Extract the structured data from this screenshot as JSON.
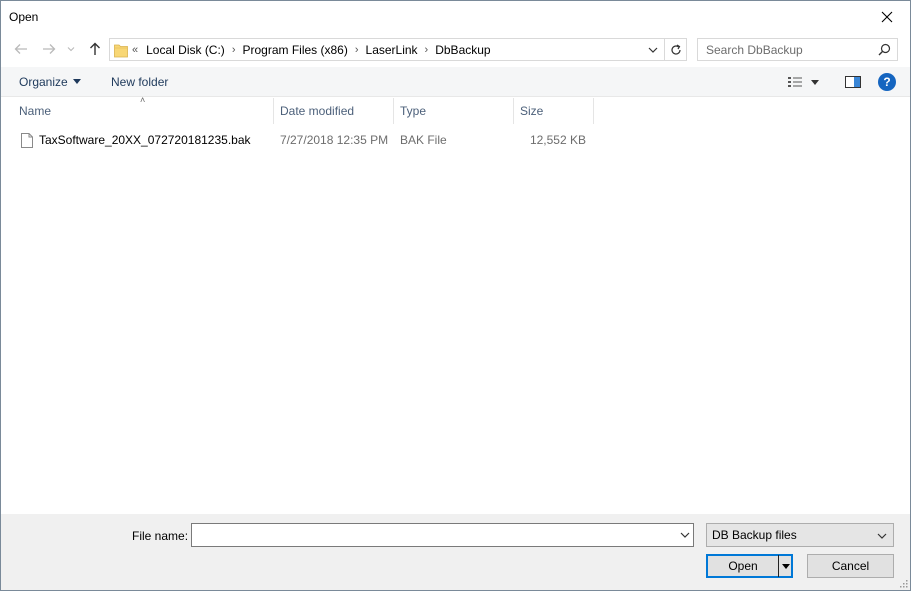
{
  "window": {
    "title": "Open"
  },
  "nav": {
    "back_icon": "arrow-left-icon",
    "forward_icon": "arrow-right-icon",
    "recent_icon": "chevron-down-icon",
    "up_icon": "arrow-up-icon"
  },
  "address": {
    "overflow": "«",
    "crumbs": [
      "Local Disk (C:)",
      "Program Files (x86)",
      "LaserLink",
      "DbBackup"
    ]
  },
  "search": {
    "placeholder": "Search DbBackup"
  },
  "commandbar": {
    "organize_label": "Organize",
    "new_folder_label": "New folder"
  },
  "columns": {
    "name": "Name",
    "date_modified": "Date modified",
    "type": "Type",
    "size": "Size"
  },
  "files": [
    {
      "name": "TaxSoftware_20XX_072720181235.bak",
      "date_modified": "7/27/2018 12:35 PM",
      "type": "BAK File",
      "size": "12,552 KB"
    }
  ],
  "bottom": {
    "file_name_label": "File name:",
    "file_name_value": "",
    "file_type_selected": "DB Backup files",
    "open_label": "Open",
    "cancel_label": "Cancel"
  },
  "colors": {
    "accent": "#0078d7",
    "help_blue": "#1565c0",
    "folder_yellow": "#f8d775",
    "header_text": "#4c607a"
  }
}
